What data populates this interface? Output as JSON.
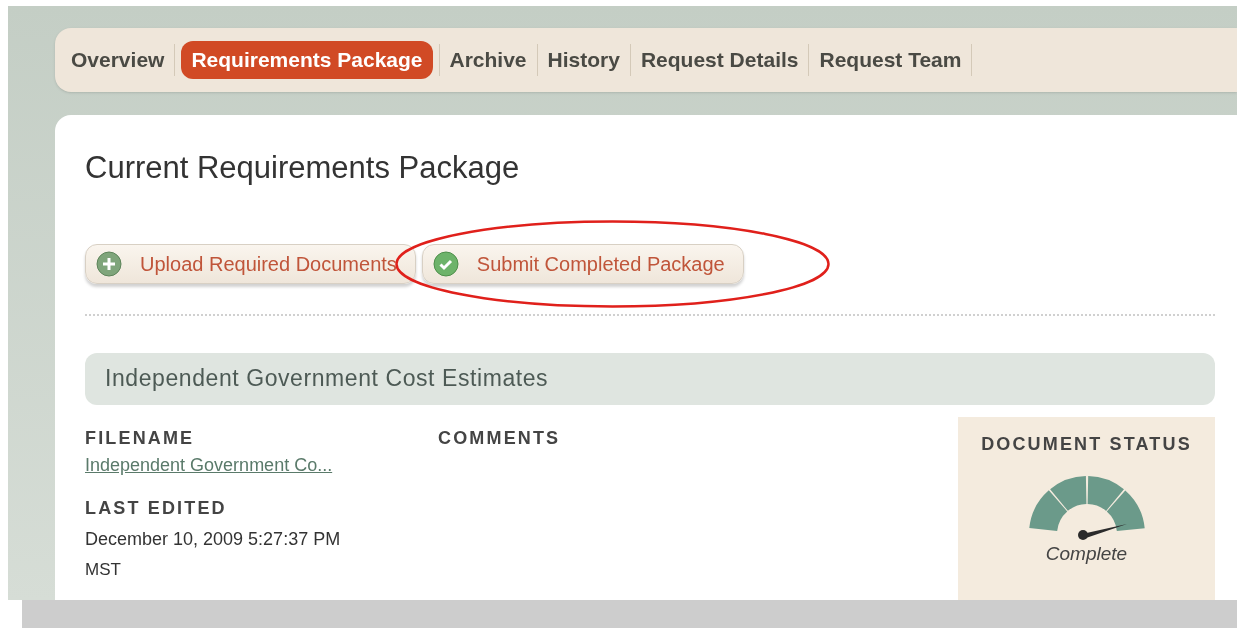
{
  "tabs": [
    {
      "label": "Overview",
      "selected": false
    },
    {
      "label": "Requirements Package",
      "selected": true
    },
    {
      "label": "Archive",
      "selected": false
    },
    {
      "label": "History",
      "selected": false
    },
    {
      "label": "Request Details",
      "selected": false
    },
    {
      "label": "Request Team",
      "selected": false
    }
  ],
  "page_title": "Current Requirements Package",
  "actions": [
    {
      "label": "Upload Required Documents",
      "kind": "add",
      "highlighted": false
    },
    {
      "label": "Submit Completed Package",
      "kind": "check",
      "highlighted": true
    }
  ],
  "section": {
    "title": "Independent Government Cost Estimates",
    "filename_label": "FILENAME",
    "filename": "Independent Government Co...",
    "last_edited_label": "LAST EDITED",
    "last_edited": "December 10, 2009 5:27:37 PM",
    "time_zone": "MST",
    "comments_label": "COMMENTS",
    "status": {
      "label": "DOCUMENT STATUS",
      "value": "Complete"
    }
  }
}
